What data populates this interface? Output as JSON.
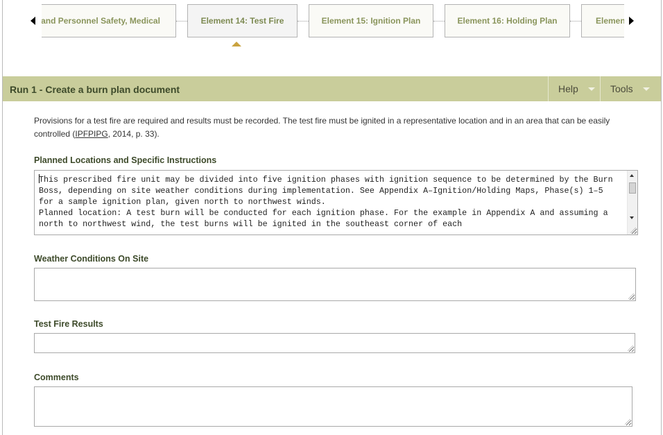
{
  "element_tabs": [
    {
      "label": "and Personnel Safety, Medical",
      "active": false
    },
    {
      "label": "Element 14: Test Fire",
      "active": true
    },
    {
      "label": "Element 15: Ignition Plan",
      "active": false
    },
    {
      "label": "Element 16: Holding Plan",
      "active": false
    },
    {
      "label": "Elemen",
      "active": false
    }
  ],
  "header": {
    "title": "Run 1 - Create a burn plan document",
    "help_label": "Help",
    "tools_label": "Tools"
  },
  "description": {
    "before_link": "Provisions for a test fire are required and results must be recorded. The test fire must be ignited in a representative location and in an area that can be easily controlled (",
    "link_text": "IPFPIPG",
    "after_link": ", 2014, p. 33)."
  },
  "fields": {
    "planned_locations": {
      "label": "Planned Locations and Specific Instructions",
      "value": "This prescribed fire unit may be divided into five ignition phases with ignition sequence to be determined by the Burn Boss, depending on site weather conditions during implementation. See Appendix A–Ignition/Holding Maps, Phase(s) 1–5 for a sample ignition plan, given north to northwest winds.\nPlanned location: A test burn will be conducted for each ignition phase. For the example in Appendix A and assuming a north to northwest wind, the test burns will be ignited in the southeast corner of each"
    },
    "weather": {
      "label": "Weather Conditions On Site",
      "value": ""
    },
    "results": {
      "label": "Test Fire Results",
      "value": ""
    },
    "comments": {
      "label": "Comments",
      "value": ""
    }
  }
}
